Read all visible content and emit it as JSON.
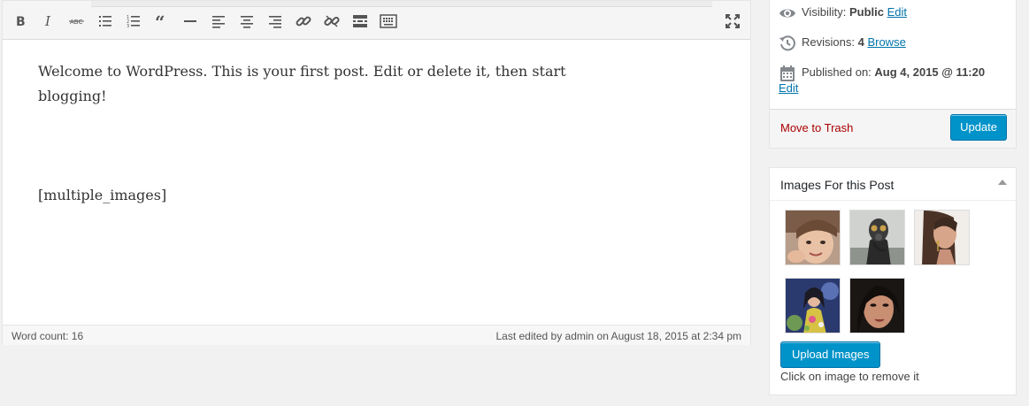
{
  "editor": {
    "toolbar": {
      "buttons": [
        "bold-icon",
        "italic-icon",
        "strikethrough-icon",
        "bulleted-list-icon",
        "numbered-list-icon",
        "blockquote-icon",
        "horizontal-line-icon",
        "align-left-icon",
        "align-center-icon",
        "align-right-icon",
        "insert-link-icon",
        "remove-link-icon",
        "read-more-icon",
        "toolbar-toggle-icon"
      ],
      "fullscreen": "fullscreen-icon"
    },
    "content": {
      "paragraph": "Welcome to WordPress. This is your first post. Edit or delete it, then start blogging!",
      "shortcode": "[multiple_images]"
    },
    "status": {
      "word_count": "Word count: 16",
      "last_edited": "Last edited by admin on August 18, 2015 at 2:34 pm"
    }
  },
  "publish": {
    "visibility": {
      "label": "Visibility:",
      "value": "Public",
      "link": "Edit"
    },
    "revisions": {
      "label": "Revisions:",
      "value": "4",
      "link": "Browse"
    },
    "published": {
      "label": "Published on:",
      "value": "Aug 4, 2015 @ 11:20",
      "link": "Edit"
    },
    "trash_label": "Move to Trash",
    "update_label": "Update"
  },
  "images_box": {
    "title": "Images For this Post",
    "upload_label": "Upload Images",
    "hint": "Click on image to remove it"
  },
  "colors": {
    "primary_button": "#0093c9",
    "link": "#0073aa",
    "trash": "#aa0000"
  }
}
